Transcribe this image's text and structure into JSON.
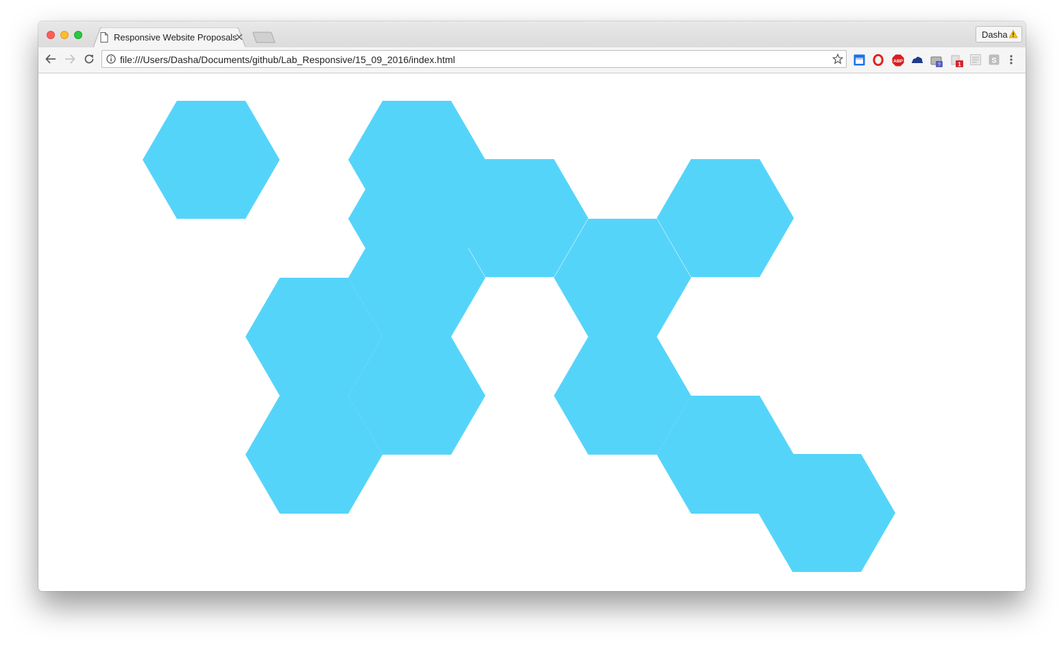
{
  "browser": {
    "tab_title": "Responsive Website Proposals",
    "profile_name": "Dasha",
    "url": "file:///Users/Dasha/Documents/github/Lab_Responsive/15_09_2016/index.html",
    "extension_badge": "1",
    "extension_labels": {
      "abp": "ABP",
      "s": "S"
    }
  },
  "page": {
    "hexagon_color": "#55d4fa",
    "hexagons": [
      "hex-1",
      "hex-2",
      "hex-3",
      "hex-4",
      "hex-5",
      "hex-6",
      "hex-7",
      "hex-8",
      "hex-9",
      "hex-10",
      "hex-11",
      "hex-12",
      "hex-13"
    ]
  }
}
